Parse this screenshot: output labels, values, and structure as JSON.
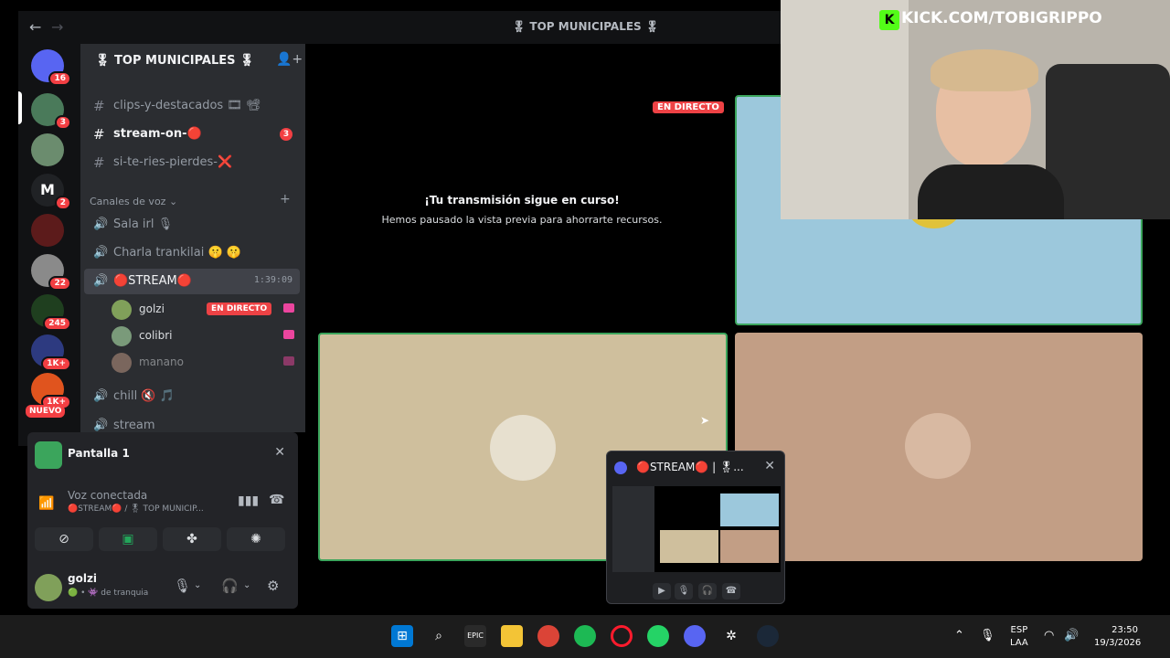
{
  "window": {
    "title": "🎖 TOP MUNICIPALES 🎖",
    "back": "←",
    "forward": "→"
  },
  "server": {
    "name": "🎖 TOP MUNICIPALES 🎖",
    "chevron": "⌄"
  },
  "rail": {
    "badges": [
      "16",
      "3",
      "2",
      "22",
      "245",
      "1K+",
      "1K+"
    ],
    "nuevo": "NUEVO",
    "initial": "M"
  },
  "channels": {
    "text": [
      {
        "name": "clips-y-destacados 🎞 📽",
        "hash": "#"
      },
      {
        "name": "stream-on-🔴",
        "hash": "#",
        "badge": "3"
      },
      {
        "name": "si-te-ries-pierdes-❌",
        "hash": "#"
      }
    ],
    "voice_header": "Canales de voz ⌄",
    "voice_add": "+",
    "voice": [
      {
        "name": "Sala irl 🎙"
      },
      {
        "name": "Charla trankilai 🤫 🤫"
      },
      {
        "name": "🔴STREAM🔴",
        "timer": "1:39:09"
      }
    ],
    "voice_users": [
      {
        "name": "golzi",
        "live": "EN DIRECTO"
      },
      {
        "name": "colibri"
      },
      {
        "name": "manano"
      }
    ],
    "after": [
      {
        "name": "chill 🔇 🎵"
      },
      {
        "name": "stream"
      }
    ]
  },
  "screen_share": {
    "name": "Pantalla 1",
    "close": "✕"
  },
  "voice_panel": {
    "status": "Voz conectada",
    "where": "🔴STREAM🔴 / 🎖 TOP MUNICIP..."
  },
  "user": {
    "name": "golzi",
    "status": "🟢 • 👾 de tranquia"
  },
  "stage": {
    "live_tag": "EN DIRECTO",
    "paused_title": "¡Tu transmisión sigue en curso!",
    "paused_sub": "Hemos pausado la vista previa para ahorrarte recursos."
  },
  "overlay": {
    "brand": "KICK.COM/TOBIGRIPPO",
    "logo_letter": "K"
  },
  "popout": {
    "title": "🔴STREAM🔴 | 🎖...",
    "close": "✕"
  },
  "taskbar": {
    "lang_top": "ESP",
    "lang_bottom": "LAA",
    "time": "23:50",
    "date": "19/3/2026"
  },
  "colors": {
    "accent": "#5865f2",
    "live": "#ed4245",
    "connected": "#23a55a",
    "kick": "#53fc18"
  }
}
